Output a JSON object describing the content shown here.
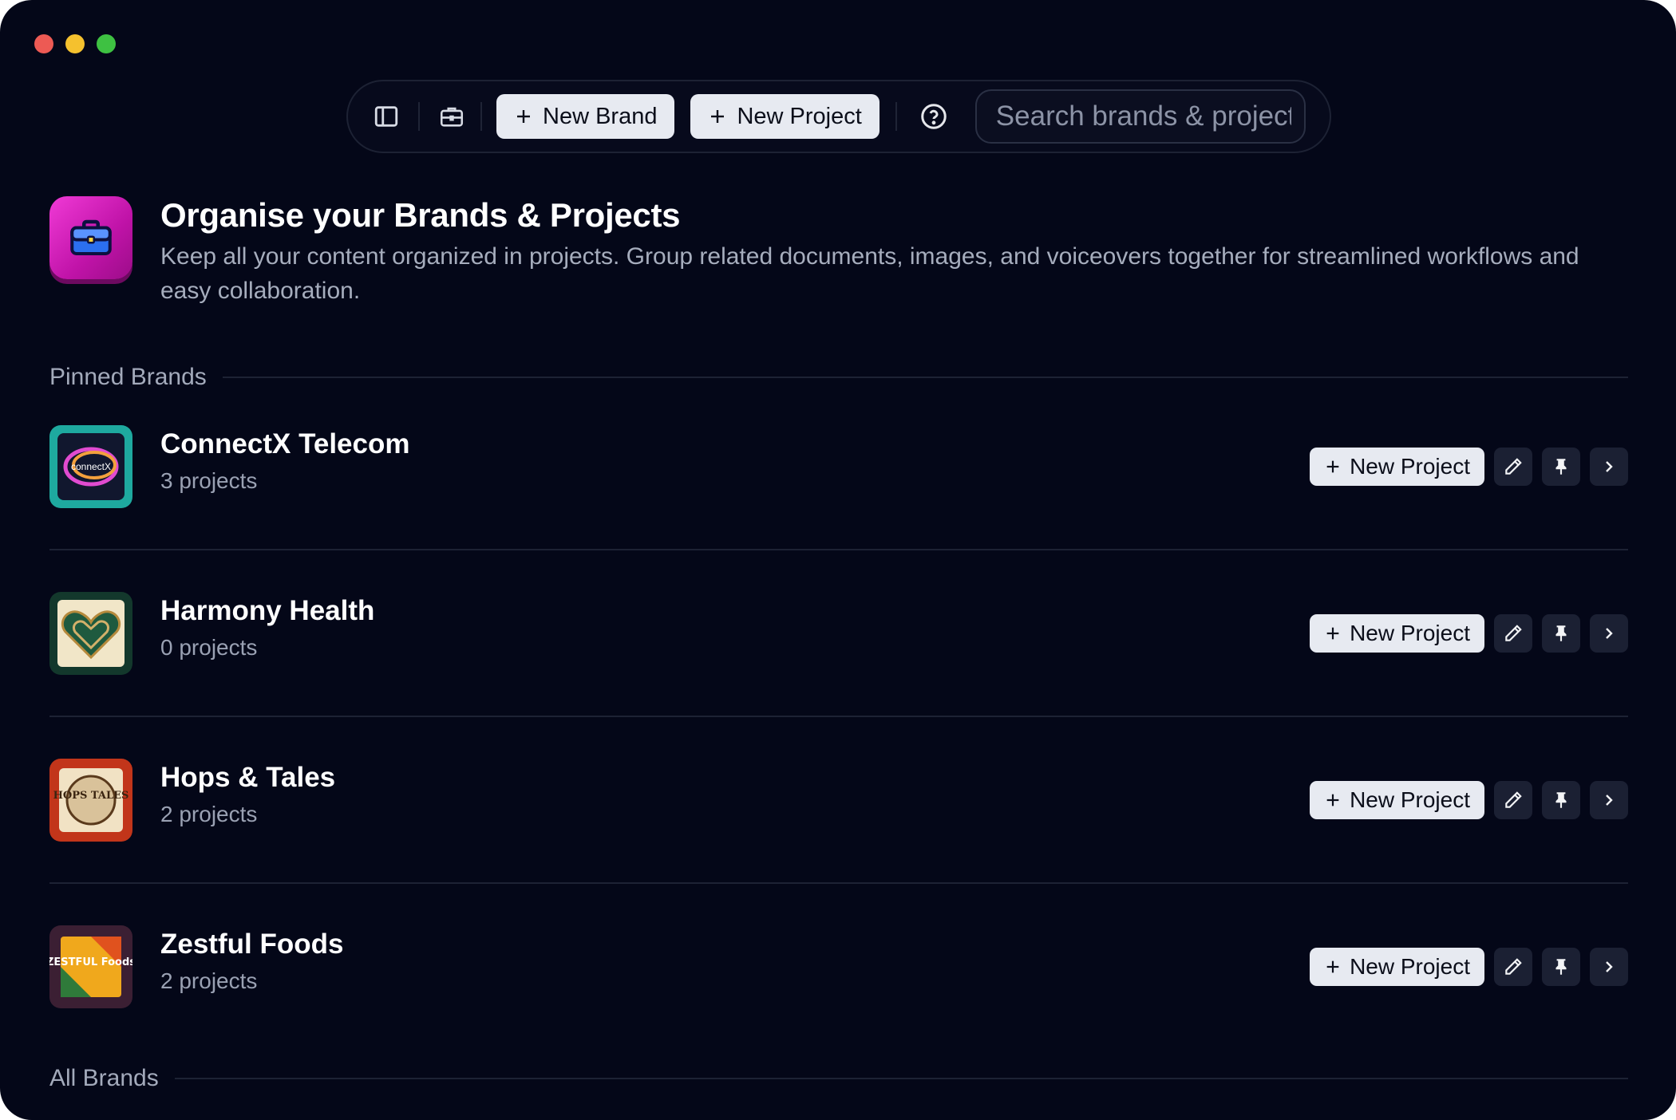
{
  "window": {
    "traffic_lights": {
      "close": "#ed5a54",
      "minimize": "#f5c12e",
      "zoom": "#3ec142"
    }
  },
  "toolbar": {
    "sidebar_toggle_icon": "sidebar-icon",
    "briefcase_icon": "briefcase-icon",
    "new_brand_label": "New Brand",
    "new_project_label": "New Project",
    "help_icon": "question-circle-icon",
    "search": {
      "placeholder": "Search brands & projects",
      "value": ""
    }
  },
  "hero": {
    "icon": "briefcase-icon",
    "icon_color": "#e125c9",
    "title": "Organise your Brands & Projects",
    "description": "Keep all your content organized in projects. Group related documents, images, and voiceovers together for streamlined workflows and easy collaboration."
  },
  "sections": {
    "pinned_label": "Pinned Brands",
    "all_label": "All Brands"
  },
  "pinned_brands": [
    {
      "name": "ConnectX Telecom",
      "count": "3 projects",
      "logo_text": "connectX",
      "new_project_label": "New Project"
    },
    {
      "name": "Harmony Health",
      "count": "0 projects",
      "logo_text": "",
      "new_project_label": "New Project"
    },
    {
      "name": "Hops & Tales",
      "count": "2 projects",
      "logo_text": "HOPS TALES",
      "new_project_label": "New Project"
    },
    {
      "name": "Zestful Foods",
      "count": "2 projects",
      "logo_text": "ZESTFUL Foods",
      "new_project_label": "New Project"
    }
  ],
  "colors": {
    "background": "#040718",
    "button_bg": "#e7eaf1",
    "icon_button_bg": "#1b2033",
    "muted_text": "#a3aabb"
  }
}
